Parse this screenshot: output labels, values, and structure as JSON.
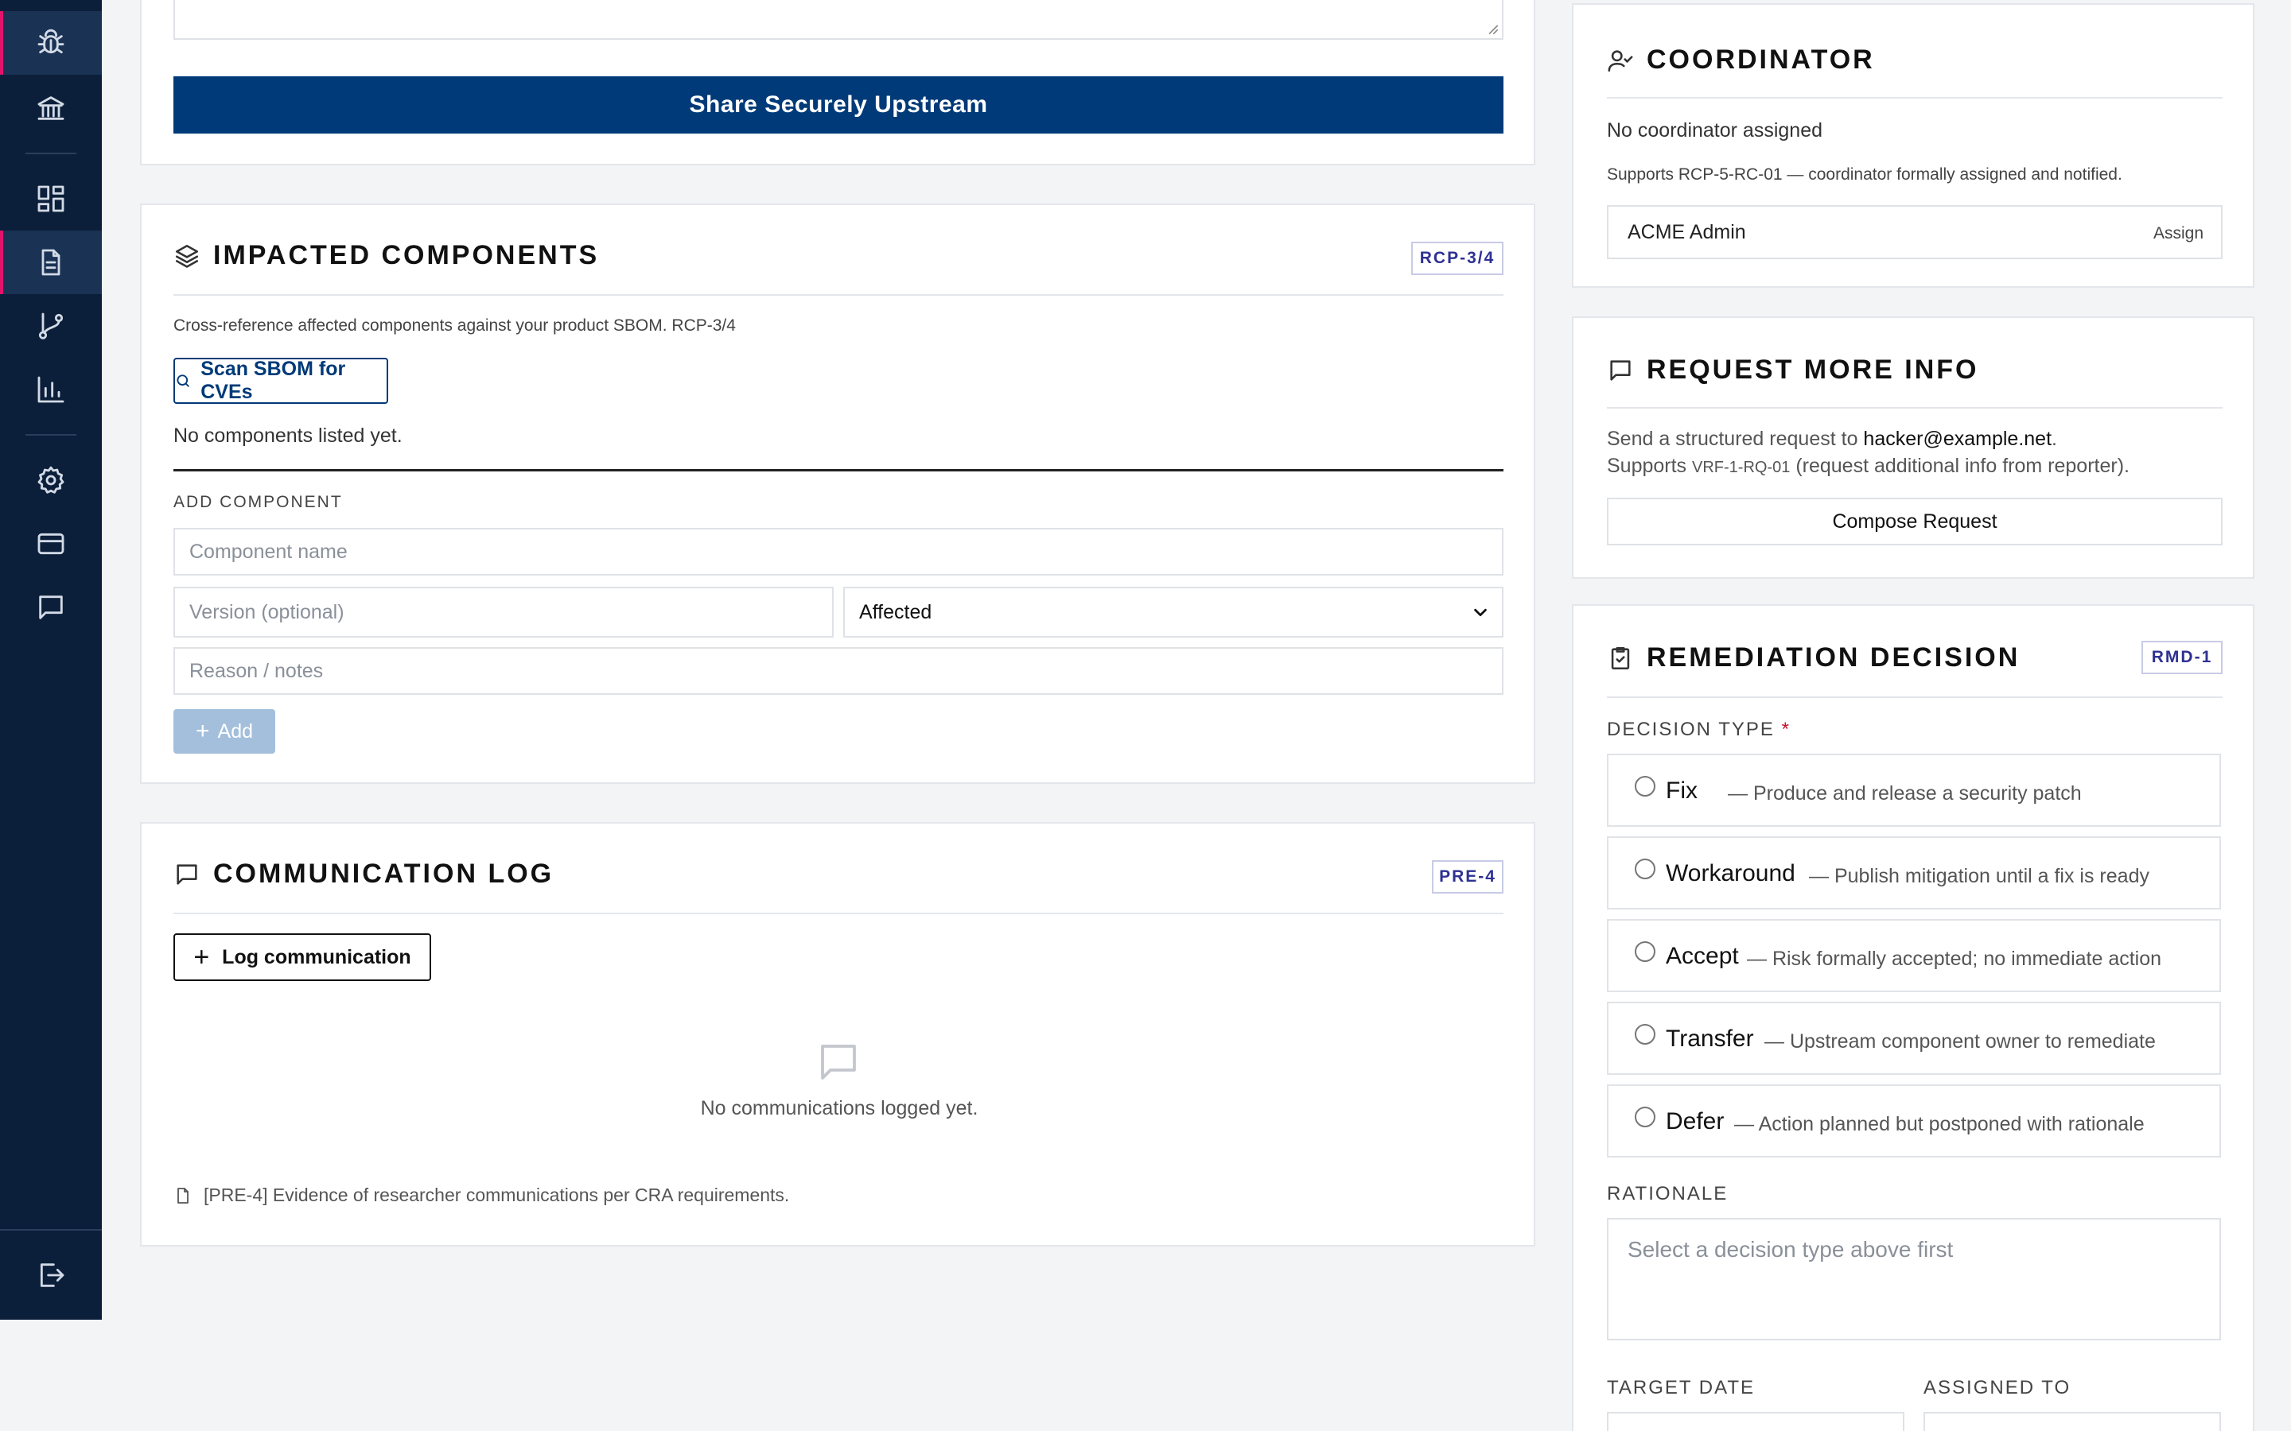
{
  "sidebar": {
    "icons": [
      "bug-icon",
      "institution-icon",
      "dashboard-grid-icon",
      "document-icon",
      "git-branch-icon",
      "bar-chart-icon",
      "gear-icon",
      "credit-card-icon",
      "chat-icon",
      "logout-icon"
    ]
  },
  "share_panel": {
    "button_label": "Share Securely Upstream"
  },
  "impacted": {
    "title": "IMPACTED COMPONENTS",
    "tag": "RCP-3/4",
    "description": "Cross-reference affected components against your product SBOM. RCP-3/4",
    "scan_button": "Scan SBOM for CVEs",
    "empty_text": "No components listed yet.",
    "add_heading": "ADD COMPONENT",
    "component_placeholder": "Component name",
    "version_placeholder": "Version (optional)",
    "status_selected": "Affected",
    "reason_placeholder": "Reason / notes",
    "add_button": "Add"
  },
  "comm_log": {
    "title": "COMMUNICATION LOG",
    "tag": "PRE-4",
    "log_button": "Log communication",
    "empty_text": "No communications logged yet.",
    "footnote": "[PRE-4] Evidence of researcher communications per CRA requirements."
  },
  "coordinator": {
    "title": "COORDINATOR",
    "status": "No coordinator assigned",
    "supports": "Supports RCP-5-RC-01 — coordinator formally assigned and notified.",
    "selected_user": "ACME Admin",
    "assign_label": "Assign"
  },
  "request_info": {
    "title": "REQUEST MORE INFO",
    "line1_prefix": "Send a structured request to ",
    "email": "hacker@example.net",
    "line1_suffix": ".",
    "line2_prefix": "Supports ",
    "code": "VRF-1-RQ-01",
    "line2_suffix": " (request additional info from reporter).",
    "button": "Compose Request"
  },
  "remediation": {
    "title": "REMEDIATION DECISION",
    "tag": "RMD-1",
    "decision_label": "DECISION TYPE",
    "required_mark": "*",
    "options": [
      {
        "label": "Fix",
        "desc": "— Produce and release a security patch"
      },
      {
        "label": "Workaround",
        "desc": "— Publish mitigation until a fix is ready"
      },
      {
        "label": "Accept",
        "desc": "— Risk formally accepted; no immediate action"
      },
      {
        "label": "Transfer",
        "desc": "— Upstream component owner to remediate"
      },
      {
        "label": "Defer",
        "desc": "— Action planned but postponed with rationale"
      }
    ],
    "rationale_label": "RATIONALE",
    "rationale_placeholder": "Select a decision type above first",
    "target_date_label": "TARGET DATE",
    "assigned_to_label": "ASSIGNED TO"
  },
  "colors": {
    "sidebar_bg": "#0c1f3a",
    "accent_pink": "#e0146c",
    "primary_navy": "#003a78",
    "tag_text": "#2e3192"
  }
}
